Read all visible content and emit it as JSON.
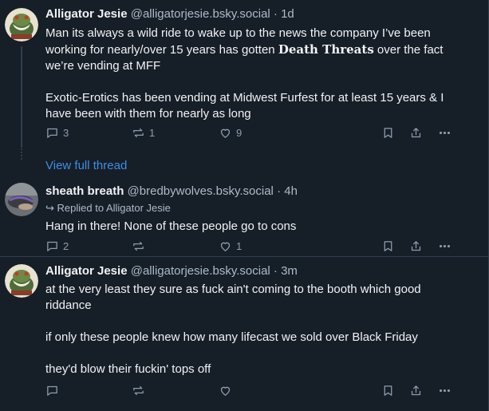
{
  "posts": [
    {
      "author": "Alligator Jesie",
      "handle": "@alligatorjesie.bsky.social",
      "time": "· 1d",
      "line1": "Man its always a wild ride to wake up to the news the company I’ve been working for nearly/over 15 years has gotten ",
      "emph": "Death Threats",
      "line1_end": " over the fact we’re vending at MFF",
      "para2": "Exotic-Erotics has been vending at Midwest Furfest for at least 15 years & I have been with them for nearly as long",
      "replies": "3",
      "reposts": "1",
      "likes": "9"
    },
    {
      "author": "sheath breath",
      "handle": "@bredbywolves.bsky.social",
      "time": "· 4h",
      "reply_to": "Replied to Alligator Jesie",
      "text": "Hang in there! None of these people go to cons",
      "replies": "2",
      "likes": "1"
    },
    {
      "author": "Alligator Jesie",
      "handle": "@alligatorjesie.bsky.social",
      "time": "· 3m",
      "para1": "at the very least they sure as fuck ain't coming to the booth which good riddance",
      "para2": "if only these people knew how many lifecast we sold over Black Friday",
      "para3": "they'd blow their fuckin' tops off"
    }
  ],
  "view_full_thread": "View full thread",
  "icons": [
    "reply-icon",
    "repost-icon",
    "like-icon",
    "bookmark-icon",
    "share-icon",
    "more-icon",
    "reply-arrow-icon"
  ]
}
